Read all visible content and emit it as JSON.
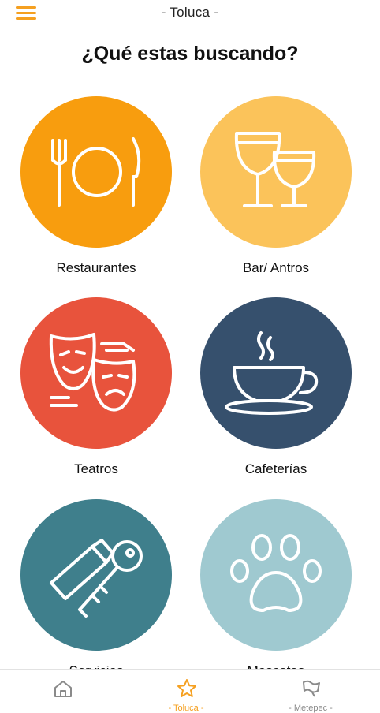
{
  "header": {
    "title": "- Toluca -",
    "menu_icon": "hamburger-menu-icon"
  },
  "page": {
    "title": "¿Qué estas buscando?"
  },
  "categories": [
    {
      "label": "Restaurantes",
      "color": "#f89d0e",
      "icon": "fork-plate-knife-icon"
    },
    {
      "label": "Bar/ Antros",
      "color": "#fbc35a",
      "icon": "wine-glasses-icon"
    },
    {
      "label": "Teatros",
      "color": "#e8533c",
      "icon": "theater-masks-icon"
    },
    {
      "label": "Cafeterías",
      "color": "#36506d",
      "icon": "coffee-cup-icon"
    },
    {
      "label": "Servicios",
      "color": "#3f7f8c",
      "icon": "key-tag-icon"
    },
    {
      "label": "Mascotas",
      "color": "#9fc9d0",
      "icon": "paw-print-icon"
    }
  ],
  "tabbar": {
    "tabs": [
      {
        "label": "",
        "icon": "home-icon",
        "active": false
      },
      {
        "label": "- Toluca -",
        "icon": "star-icon",
        "active": true
      },
      {
        "label": "- Metepec -",
        "icon": "flag-icon",
        "active": false
      }
    ]
  },
  "colors": {
    "accent": "#f5a020",
    "tab_inactive": "#8a8a8a"
  }
}
